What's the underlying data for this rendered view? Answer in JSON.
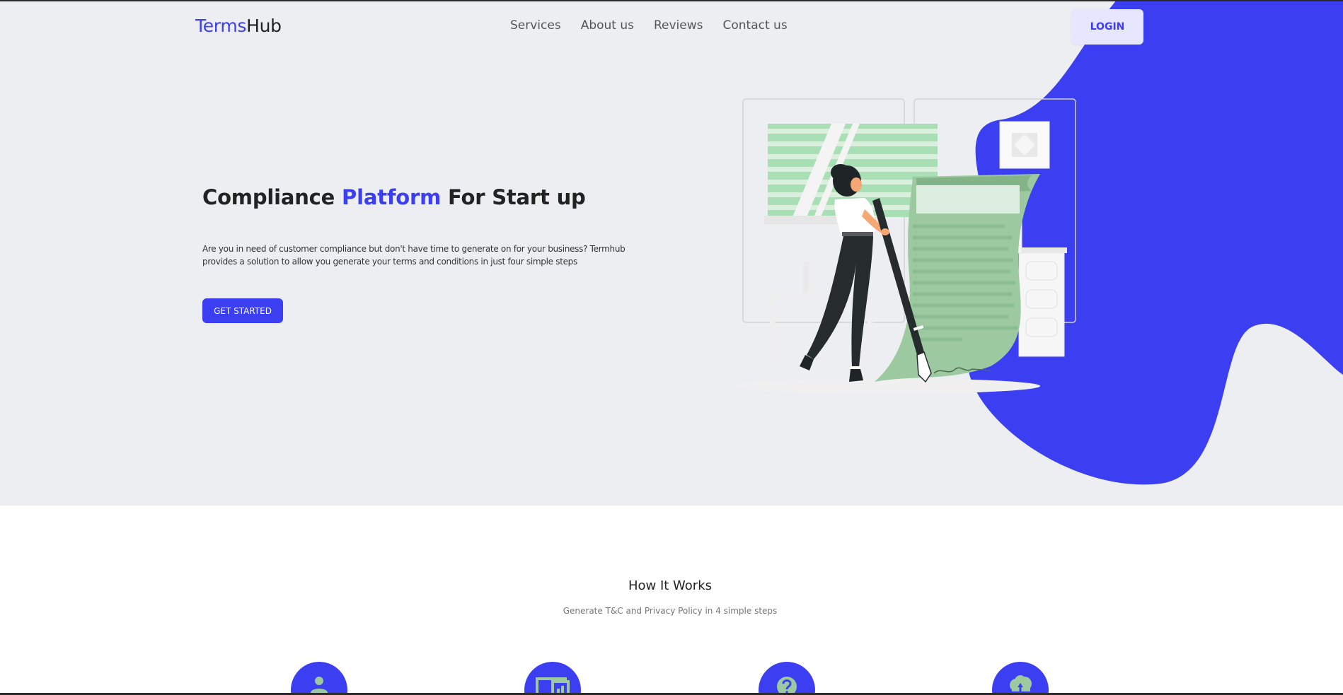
{
  "header": {
    "logo_part1": "Terms",
    "logo_part2": "Hub",
    "nav": [
      "Services",
      "About us",
      "Reviews",
      "Contact us"
    ],
    "login_label": "LOGIN"
  },
  "hero": {
    "title_part1": "Compliance ",
    "title_accent": "Platform",
    "title_part2": " For Start up",
    "description": "Are you in need of customer compliance but don't have time to generate on for your business? Termhub provides a solution to allow you generate your terms and conditions in just four simple steps",
    "cta_label": "GET STARTED"
  },
  "how_it_works": {
    "title": "How It Works",
    "subtitle": "Generate T&C and Privacy Policy in 4 simple steps",
    "steps": [
      {
        "icon": "user-icon"
      },
      {
        "icon": "dashboard-icon"
      },
      {
        "icon": "question-icon"
      },
      {
        "icon": "cloud-upload-icon"
      }
    ]
  },
  "colors": {
    "accent": "#3b3ff1",
    "hero_bg": "#eceef1",
    "illustration_green": "#9cc9a0"
  }
}
